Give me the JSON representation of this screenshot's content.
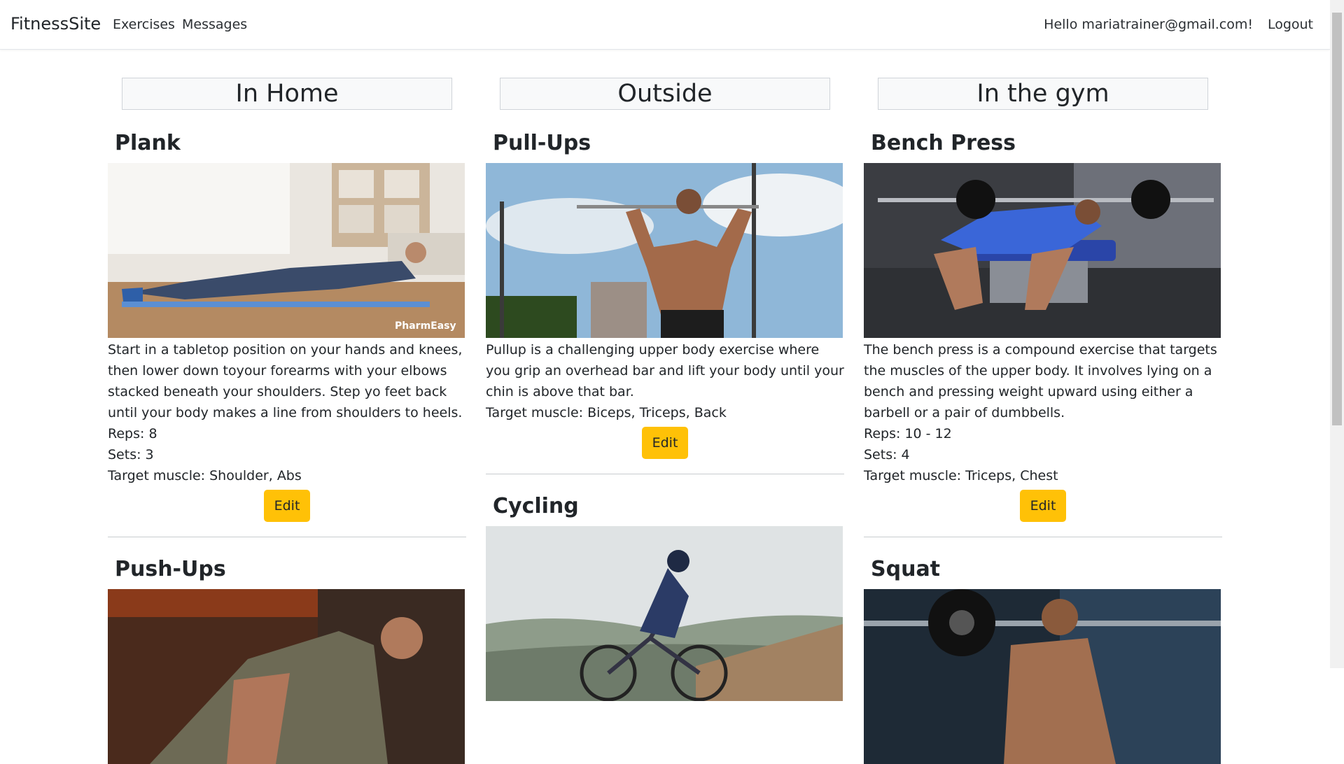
{
  "navbar": {
    "brand": "FitnessSite",
    "links": [
      "Exercises",
      "Messages"
    ],
    "greeting": "Hello mariatrainer@gmail.com!",
    "logout": "Logout"
  },
  "columns": [
    {
      "header": "In Home",
      "cards": [
        {
          "title": "Plank",
          "image": "plank-photo",
          "watermark": "PharmEasy",
          "description": "Start in a tabletop position on your hands and knees, then lower down toyour forearms with your elbows stacked beneath your shoulders. Step yo feet back until your body makes a line from shoulders to heels.",
          "reps": "Reps: 8",
          "sets": "Sets: 3",
          "target": "Target muscle: Shoulder, Abs",
          "edit": "Edit"
        },
        {
          "title": "Push-Ups",
          "image": "pushups-photo"
        }
      ]
    },
    {
      "header": "Outside",
      "cards": [
        {
          "title": "Pull-Ups",
          "image": "pullups-photo",
          "description": "Pullup is a challenging upper body exercise where you grip an overhead bar and lift your body until your chin is above that bar.",
          "target": "Target muscle: Biceps, Triceps, Back",
          "edit": "Edit"
        },
        {
          "title": "Cycling",
          "image": "cycling-photo"
        }
      ]
    },
    {
      "header": "In the gym",
      "cards": [
        {
          "title": "Bench Press",
          "image": "benchpress-photo",
          "description": "The bench press is a compound exercise that targets the muscles of the upper body. It involves lying on a bench and pressing weight upward using either a barbell or a pair of dumbbells.",
          "reps": "Reps: 10 - 12",
          "sets": "Sets: 4",
          "target": "Target muscle: Triceps, Chest",
          "edit": "Edit"
        },
        {
          "title": "Squat",
          "image": "squat-photo"
        }
      ]
    }
  ],
  "colors": {
    "edit_button": "#ffc107",
    "header_bg": "#f8f9fa"
  }
}
